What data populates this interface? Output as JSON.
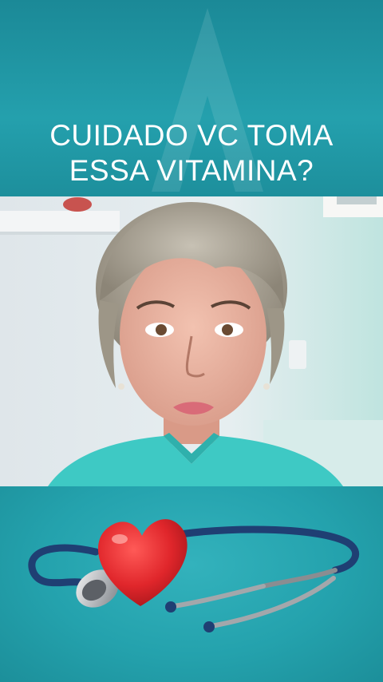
{
  "headline": {
    "line1": "CUIDADO VC TOMA",
    "line2": "ESSA VITAMINA?"
  },
  "colors": {
    "banner": "#1e8f9c",
    "headline_text": "#ffffff",
    "scrubs": "#3ec9c4",
    "heart": "#e0262b",
    "stethoscope_tube": "#1f3f73"
  },
  "icons": {
    "watermark": "triangle-watermark-icon",
    "heart": "heart-icon",
    "stethoscope": "stethoscope-icon"
  }
}
